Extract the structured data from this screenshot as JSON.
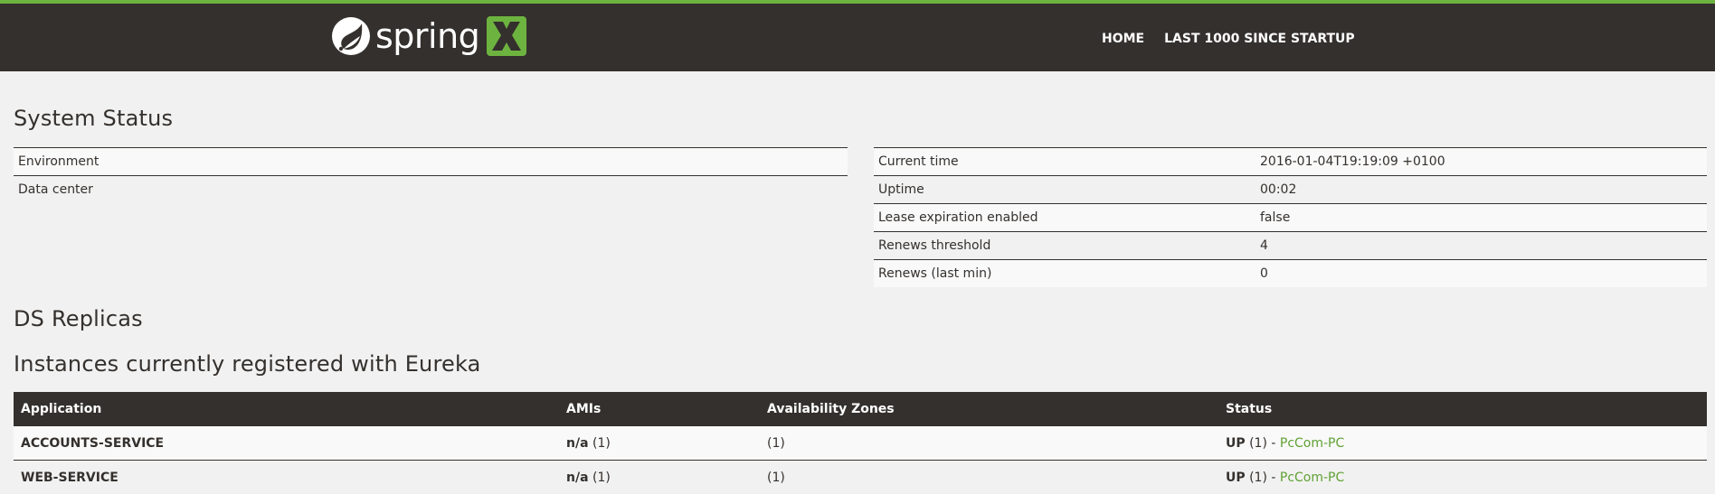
{
  "navbar": {
    "brand_text": "spring",
    "brand_leaf_icon": "spring-leaf-icon",
    "brand_x_icon": "x-logo-icon",
    "links": [
      {
        "label": "HOME"
      },
      {
        "label": "LAST 1000 SINCE STARTUP"
      }
    ],
    "colors": {
      "bar": "#34302d",
      "accent": "#6db33f"
    }
  },
  "system_status": {
    "title": "System Status",
    "environment_rows": [
      {
        "label": "Environment",
        "value": ""
      },
      {
        "label": "Data center",
        "value": ""
      }
    ],
    "time_rows": [
      {
        "label": "Current time",
        "value": "2016-01-04T19:19:09 +0100"
      },
      {
        "label": "Uptime",
        "value": "00:02"
      },
      {
        "label": "Lease expiration enabled",
        "value": "false"
      },
      {
        "label": "Renews threshold",
        "value": "4"
      },
      {
        "label": "Renews (last min)",
        "value": "0"
      }
    ]
  },
  "ds_replicas": {
    "title": "DS Replicas"
  },
  "instances": {
    "title": "Instances currently registered with Eureka",
    "columns": [
      "Application",
      "AMIs",
      "Availability Zones",
      "Status"
    ],
    "rows": [
      {
        "application": "ACCOUNTS-SERVICE",
        "ami": "n/a",
        "ami_count": "(1)",
        "zones": "(1)",
        "status": "UP",
        "status_count": "(1) -",
        "instance": "PcCom-PC"
      },
      {
        "application": "WEB-SERVICE",
        "ami": "n/a",
        "ami_count": "(1)",
        "zones": "(1)",
        "status": "UP",
        "status_count": "(1) -",
        "instance": "PcCom-PC"
      }
    ],
    "link_color": "#5fa134"
  }
}
